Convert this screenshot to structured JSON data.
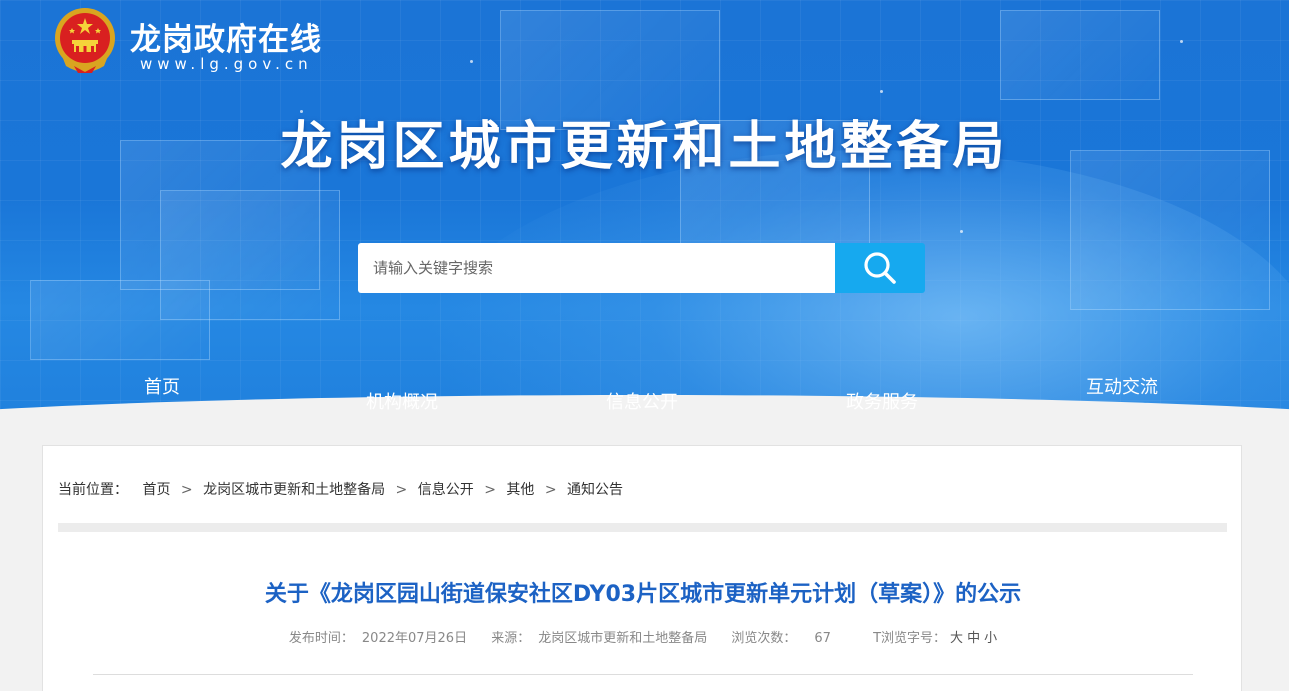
{
  "header": {
    "site_name": "龙岗政府在线",
    "site_url": "www.lg.gov.cn",
    "department_title": "龙岗区城市更新和土地整备局"
  },
  "search": {
    "placeholder": "请输入关键字搜索",
    "button_icon": "search-icon"
  },
  "nav": {
    "items": [
      {
        "label": "首页"
      },
      {
        "label": "机构概况"
      },
      {
        "label": "信息公开"
      },
      {
        "label": "政务服务"
      },
      {
        "label": "互动交流"
      }
    ]
  },
  "breadcrumb": {
    "prefix": "当前位置：",
    "items": [
      "首页",
      "龙岗区城市更新和土地整备局",
      "信息公开",
      "其他",
      "通知公告"
    ],
    "separator": ">"
  },
  "article": {
    "title": "关于《龙岗区园山街道保安社区DY03片区城市更新单元计划（草案）》的公示",
    "publish_label": "发布时间：",
    "publish_date": "2022年07月26日",
    "source_label": "来源：",
    "source": "龙岗区城市更新和土地整备局",
    "views_label": "浏览次数：",
    "views": "67",
    "font_size_label": "T浏览字号：",
    "font_sizes": [
      "大",
      "中",
      "小"
    ]
  },
  "colors": {
    "banner_blue": "#1b74d6",
    "search_button": "#16a9ef",
    "title_blue": "#1c62c4"
  }
}
